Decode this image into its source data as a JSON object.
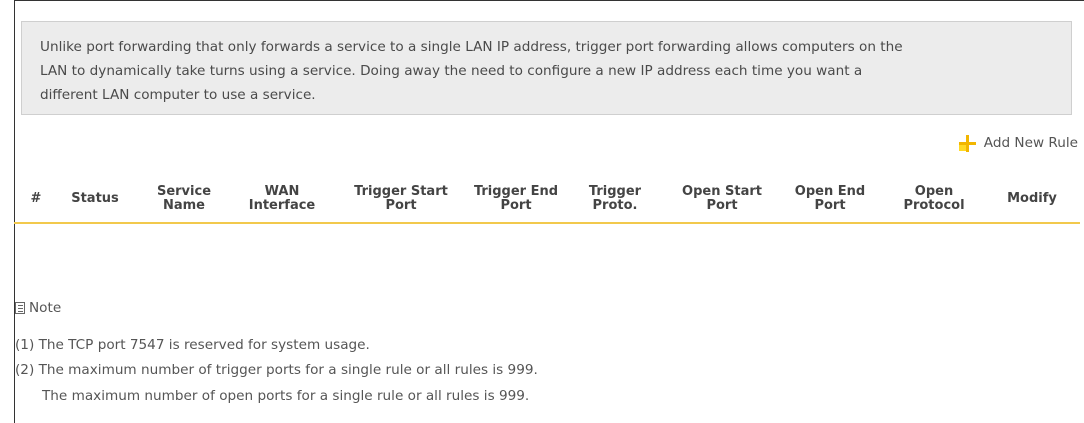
{
  "intro": {
    "line1": "Unlike port forwarding that only forwards a service to a single LAN IP address, trigger port forwarding allows computers on the",
    "line2": "LAN to dynamically take turns using a service. Doing away the need to configure a new IP address each time you want a",
    "line3": "different LAN computer to use a service."
  },
  "actions": {
    "add_new_rule": "Add New Rule",
    "add_icon": "plus-icon",
    "accent_color": "#f2b600"
  },
  "table": {
    "columns": [
      "#",
      "Status",
      "Service\nName",
      "WAN\nInterface",
      "Trigger Start\nPort",
      "Trigger End\nPort",
      "Trigger\nProto.",
      "Open Start\nPort",
      "Open End\nPort",
      "Open\nProtocol",
      "Modify"
    ],
    "rows": []
  },
  "note": {
    "label": "Note",
    "icon": "note-icon",
    "lines": [
      "(1) The TCP port 7547 is reserved for system usage.",
      "(2) The maximum number of trigger ports for a single rule or all rules is 999.",
      "The maximum number of open ports for a single rule or all rules is 999."
    ]
  }
}
